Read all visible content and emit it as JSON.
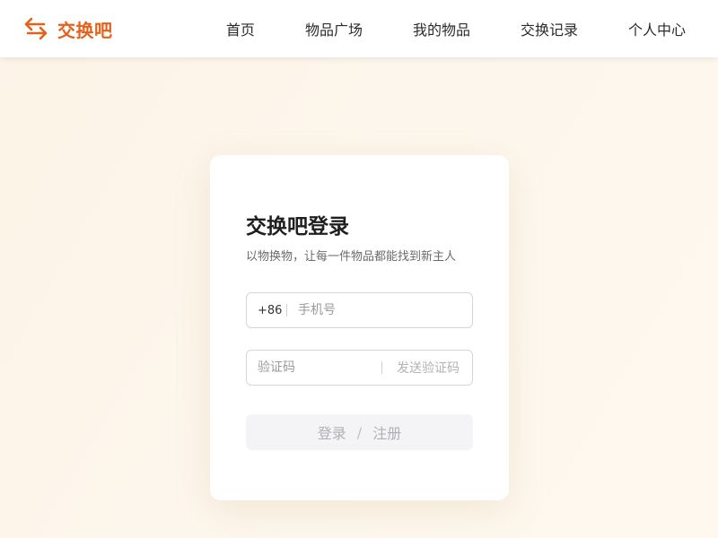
{
  "header": {
    "brand_name": "交换吧",
    "nav": [
      "首页",
      "物品广场",
      "我的物品",
      "交换记录",
      "个人中心"
    ]
  },
  "login": {
    "title": "交换吧登录",
    "subtitle": "以物换物，让每一件物品都能找到新主人",
    "phone_prefix": "+86",
    "phone_placeholder": "手机号",
    "code_placeholder": "验证码",
    "send_code_label": "发送验证码",
    "submit_login": "登录",
    "submit_separator": "/",
    "submit_register": "注册"
  },
  "colors": {
    "accent": "#e4611b",
    "background": "#fdf5ea",
    "disabled_button_bg": "#f4f4f6"
  }
}
